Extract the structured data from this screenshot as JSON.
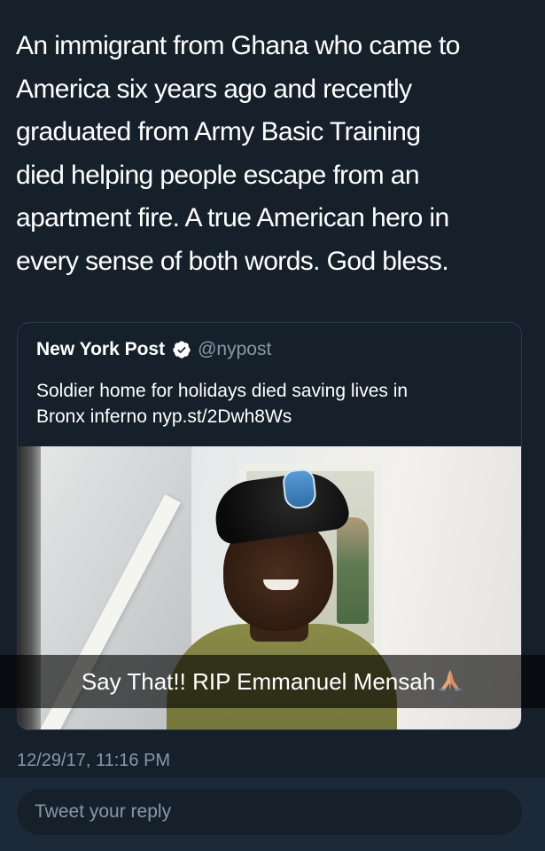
{
  "tweet": {
    "text": "An immigrant from Ghana who came to\nAmerica six years ago and recently\ngraduated from Army Basic Training\ndied helping people escape from an\napartment fire. A true American hero in\nevery sense of both words. God bless.",
    "timestamp": "12/29/17, 11:16 PM"
  },
  "quoted_tweet": {
    "author_name": "New York Post",
    "handle": "@nypost",
    "text": "Soldier home for holidays died saving lives in\nBronx inferno nyp.st/2Dwh8Ws",
    "verified_icon": "verified-badge-icon"
  },
  "overlay": {
    "caption": "Say That!! RIP Emmanuel Mensah",
    "emoji": "folded-hands-icon"
  },
  "reply": {
    "placeholder": "Tweet your reply"
  },
  "colors": {
    "background": "#15202b",
    "secondary_text": "#8899a6",
    "verified_blue": "#1da1f2",
    "reply_bar": "#1c2938"
  }
}
